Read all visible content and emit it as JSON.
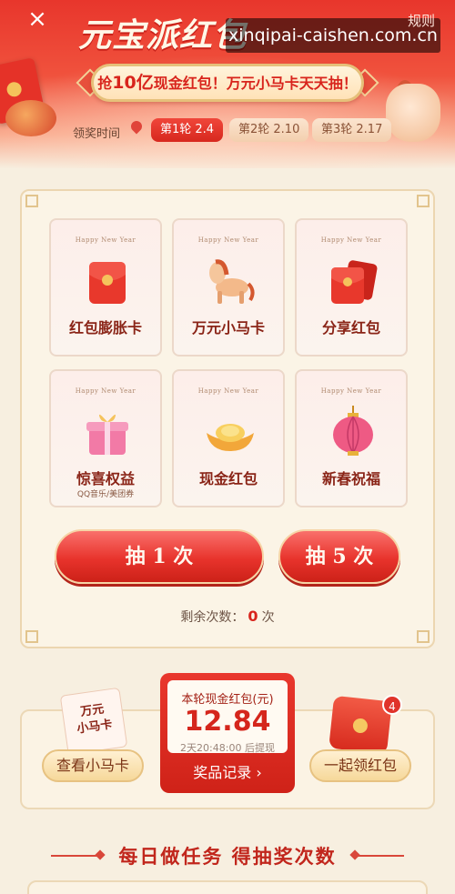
{
  "header": {
    "close": "×",
    "rules": "规则",
    "title": "元宝派红包",
    "watermark": "xinqipai-caishen.com.cn",
    "banner_prefix": "抢",
    "banner_highlight": "10亿",
    "banner_suffix": "现金红包！万元小马卡天天抽！",
    "round_label": "领奖时间",
    "rounds": [
      {
        "label": "第1轮 2.4",
        "active": true
      },
      {
        "label": "第2轮 2.10",
        "active": false
      },
      {
        "label": "第3轮 2.17",
        "active": false
      }
    ]
  },
  "prizes": [
    {
      "label": "红包膨胀卡",
      "sub": "",
      "icon": "red-envelope-icon",
      "hny": "Happy New Year"
    },
    {
      "label": "万元小马卡",
      "sub": "",
      "icon": "horse-icon",
      "hny": "Happy New Year"
    },
    {
      "label": "分享红包",
      "sub": "",
      "icon": "share-envelope-icon",
      "hny": "Happy New Year"
    },
    {
      "label": "惊喜权益",
      "sub": "QQ音乐/美团券",
      "icon": "gift-box-icon",
      "hny": "Happy New Year"
    },
    {
      "label": "现金红包",
      "sub": "",
      "icon": "gold-ingot-icon",
      "hny": "Happy New Year"
    },
    {
      "label": "新春祝福",
      "sub": "",
      "icon": "lantern-icon",
      "hny": "Happy New Year"
    }
  ],
  "draw": {
    "once": "抽 1 次",
    "five": "抽 5 次",
    "remaining_prefix": "剩余次数：",
    "remaining_count": "0",
    "remaining_suffix": "次"
  },
  "bottom": {
    "horse_card_line1": "万元",
    "horse_card_line2": "小马卡",
    "view_horse": "查看小马卡",
    "cash_title": "本轮现金红包(元)",
    "cash_amount": "12.84",
    "cash_timer": "2天20:48:00 后提现",
    "record": "奖品记录 ›",
    "collect": "一起领红包",
    "badge": "4"
  },
  "tasks": {
    "title": "每日做任务  得抽奖次数"
  },
  "colors": {
    "primary_red": "#e8332c",
    "gold": "#e6c07a",
    "background": "#f7efe0"
  }
}
